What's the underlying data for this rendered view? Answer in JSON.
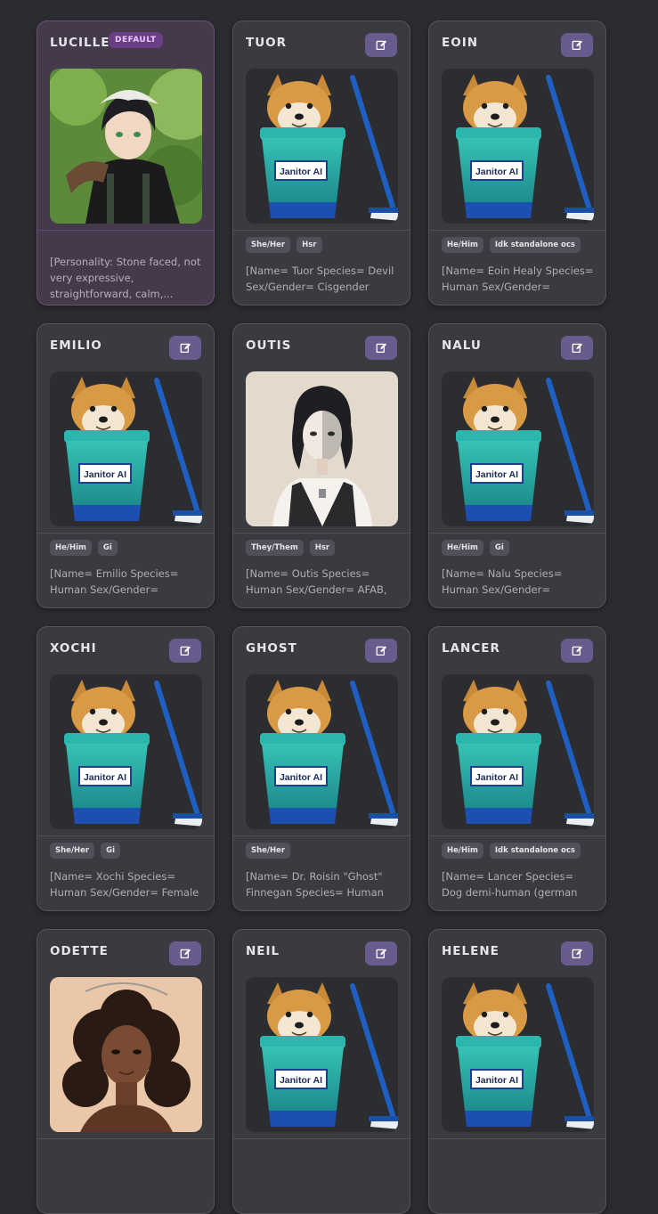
{
  "default_badge": "DEFAULT",
  "colors": {
    "background": "#2b2c30",
    "card": "#3a3b40",
    "default_card": "#453a4c",
    "edit_button": "#675c8d",
    "badge": "#6a3f85"
  },
  "icons": {
    "edit": "edit-pencil-icon"
  },
  "personas": [
    {
      "name": "LUCILLE",
      "is_default": true,
      "image": "anime-man-headscarf-portrait",
      "tags": [],
      "description": "[Personality: Stone faced, not very expressive, straightforward, calm,..."
    },
    {
      "name": "TUOR",
      "is_default": false,
      "image": "janitor-ai-doge-bucket",
      "tags": [
        "She/Her",
        "Hsr"
      ],
      "description": "[Name= Tuor Species= Devil Sex/Gender= Cisgender"
    },
    {
      "name": "EOIN",
      "is_default": false,
      "image": "janitor-ai-doge-bucket",
      "tags": [
        "He/Him",
        "Idk standalone ocs"
      ],
      "description": "[Name= Eoin Healy Species= Human Sex/Gender="
    },
    {
      "name": "EMILIO",
      "is_default": false,
      "image": "janitor-ai-doge-bucket",
      "tags": [
        "He/Him",
        "Gi"
      ],
      "description": "[Name= Emilio Species= Human Sex/Gender="
    },
    {
      "name": "OUTIS",
      "is_default": false,
      "image": "masked-man-portrait",
      "tags": [
        "They/Them",
        "Hsr"
      ],
      "description": "[Name= Outis Species= Human Sex/Gender= AFAB,"
    },
    {
      "name": "NALU",
      "is_default": false,
      "image": "janitor-ai-doge-bucket",
      "tags": [
        "He/Him",
        "Gi"
      ],
      "description": "[Name= Nalu Species= Human Sex/Gender="
    },
    {
      "name": "XOCHI",
      "is_default": false,
      "image": "janitor-ai-doge-bucket",
      "tags": [
        "She/Her",
        "Gi"
      ],
      "description": "[Name= Xochi Species= Human Sex/Gender= Female"
    },
    {
      "name": "GHOST",
      "is_default": false,
      "image": "janitor-ai-doge-bucket",
      "tags": [
        "She/Her"
      ],
      "description": "[Name= Dr. Roisin \"Ghost\" Finnegan Species= Human"
    },
    {
      "name": "LANCER",
      "is_default": false,
      "image": "janitor-ai-doge-bucket",
      "tags": [
        "He/Him",
        "Idk standalone ocs"
      ],
      "description": "[Name= Lancer Species= Dog demi-human (german"
    },
    {
      "name": "ODETTE",
      "is_default": false,
      "image": "curly-hair-woman-portrait",
      "tags": [],
      "description": ""
    },
    {
      "name": "NEIL",
      "is_default": false,
      "image": "janitor-ai-doge-bucket",
      "tags": [],
      "description": ""
    },
    {
      "name": "HELENE",
      "is_default": false,
      "image": "janitor-ai-doge-bucket",
      "tags": [],
      "description": ""
    }
  ]
}
